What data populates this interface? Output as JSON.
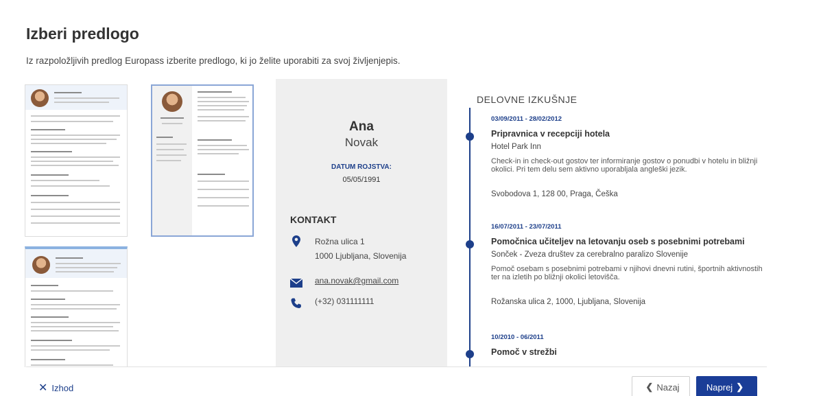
{
  "header": {
    "title": "Izberi predlogo",
    "subtitle": "Iz razpoložljivih predlog Europass izberite predlogo, ki jo želite uporabiti za svoj življenjepis."
  },
  "preview": {
    "first_name": "Ana",
    "last_name": "Novak",
    "dob_label": "DATUM ROJSTVA:",
    "dob": "05/05/1991",
    "contact_heading": "KONTAKT",
    "address_line1": "Rožna ulica 1",
    "address_line2": "1000 Ljubljana, Slovenija",
    "email": "ana.novak@gmail.com",
    "phone": "(+32) 031111111",
    "experience_heading": "DELOVNE IZKUŠNJE",
    "entries": [
      {
        "date": "03/09/2011 - 28/02/2012",
        "role": "Pripravnica v recepciji hotela",
        "org": "Hotel Park Inn",
        "desc1": "Check-in in check-out gostov ter informiranje gostov o ponudbi v hotelu in bližnji",
        "desc2": "okolici. Pri tem delu sem aktivno uporabljala angleški jezik.",
        "address": "Svobodova 1, 128 00, Praga, Češka"
      },
      {
        "date": "16/07/2011 - 23/07/2011",
        "role": "Pomočnica učiteljev na letovanju oseb s posebnimi potrebami",
        "org": "Sonček - Zveza društev za cerebralno paralizo Slovenije",
        "desc1": "Pomoč osebam s posebnimi potrebami v njihovi dnevni rutini, športnih aktivnostih",
        "desc2": "ter na izletih po bližnji okolici letovišča.",
        "address": "Rožanska ulica 2, 1000, Ljubljana, Slovenija"
      },
      {
        "date": "10/2010 - 06/2011",
        "role": "Pomoč v strežbi",
        "org": "",
        "desc1": "",
        "desc2": "",
        "address": ""
      }
    ]
  },
  "footer": {
    "exit_label": "Izhod",
    "back_label": "Nazaj",
    "next_label": "Naprej"
  },
  "colors": {
    "accent": "#1a3d97",
    "timeline": "#1d3f8a",
    "sidebar_bg": "#efefef"
  }
}
